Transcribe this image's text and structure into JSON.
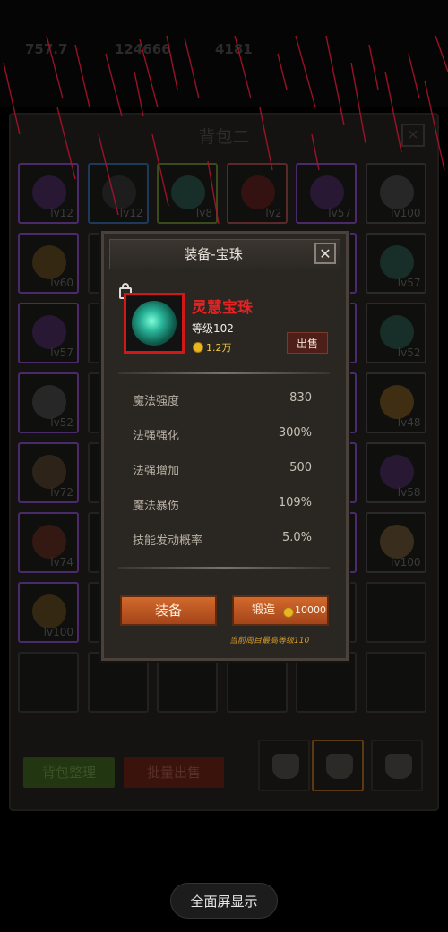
{
  "topbar": {
    "res1": "757.7",
    "res2": "124666",
    "res3": "4181"
  },
  "bag": {
    "title": "背包二",
    "sort_label": "背包整理",
    "bulk_sell_label": "批量出售",
    "slots": [
      {
        "lvl": "lv12",
        "color": "#5a2a7a"
      },
      {
        "lvl": "lv12",
        "color": "#3a3a3a"
      },
      {
        "lvl": "lv8",
        "color": "#2a6a5a"
      },
      {
        "lvl": "lv2",
        "color": "#7a1a1a"
      },
      {
        "lvl": "lv57",
        "color": "#5a2a7a"
      },
      {
        "lvl": "lv100",
        "color": "#555555"
      },
      {
        "lvl": "lv60",
        "color": "#7a5a1a"
      },
      {
        "lvl": "",
        "color": "#333333"
      },
      {
        "lvl": "",
        "color": "#333333"
      },
      {
        "lvl": "",
        "color": "#333333"
      },
      {
        "lvl": "7",
        "color": "#333333"
      },
      {
        "lvl": "lv57",
        "color": "#2a6a5a"
      },
      {
        "lvl": "lv57",
        "color": "#5a2a7a"
      },
      {
        "lvl": "",
        "color": "#333333"
      },
      {
        "lvl": "",
        "color": "#333333"
      },
      {
        "lvl": "",
        "color": "#333333"
      },
      {
        "lvl": "4",
        "color": "#333333"
      },
      {
        "lvl": "lv52",
        "color": "#2a6a5a"
      },
      {
        "lvl": "lv52",
        "color": "#555555"
      },
      {
        "lvl": "",
        "color": "#333333"
      },
      {
        "lvl": "",
        "color": "#333333"
      },
      {
        "lvl": "",
        "color": "#333333"
      },
      {
        "lvl": "3",
        "color": "#333333"
      },
      {
        "lvl": "lv48",
        "color": "#9a6a1a"
      },
      {
        "lvl": "lv72",
        "color": "#6a4a2a"
      },
      {
        "lvl": "",
        "color": "#333333"
      },
      {
        "lvl": "",
        "color": "#333333"
      },
      {
        "lvl": "",
        "color": "#333333"
      },
      {
        "lvl": "2",
        "color": "#333333"
      },
      {
        "lvl": "lv58",
        "color": "#5a2a7a"
      },
      {
        "lvl": "lv74",
        "color": "#7a2a1a"
      },
      {
        "lvl": "",
        "color": "#333333"
      },
      {
        "lvl": "",
        "color": "#333333"
      },
      {
        "lvl": "",
        "color": "#333333"
      },
      {
        "lvl": "00",
        "color": "#333333"
      },
      {
        "lvl": "lv100",
        "color": "#8a6a3a"
      },
      {
        "lvl": "lv100",
        "color": "#7a5a1a"
      },
      {
        "lvl": "",
        "color": "#333333"
      },
      {
        "lvl": "",
        "color": "#333333"
      },
      {
        "lvl": "",
        "color": "#333333"
      },
      {
        "lvl": "",
        "color": "#333333"
      },
      {
        "lvl": "",
        "color": "#333333"
      },
      {
        "lvl": "",
        "color": "#333333"
      },
      {
        "lvl": "",
        "color": "#333333"
      },
      {
        "lvl": "",
        "color": "#333333"
      },
      {
        "lvl": "",
        "color": "#333333"
      },
      {
        "lvl": "",
        "color": "#333333"
      },
      {
        "lvl": "",
        "color": "#333333"
      }
    ]
  },
  "modal": {
    "title": "装备-宝珠",
    "close_icon": "close-icon",
    "item_name": "灵慧宝珠",
    "item_level": "等级102",
    "item_price": "1.2万",
    "sell_label": "出售",
    "stats": [
      {
        "name": "魔法强度",
        "value": "830"
      },
      {
        "name": "法强强化",
        "value": "300%"
      },
      {
        "name": "法强增加",
        "value": "500"
      },
      {
        "name": "魔法暴伤",
        "value": "109%"
      },
      {
        "name": "技能发动概率",
        "value": "5.0%"
      }
    ],
    "equip_label": "装备",
    "forge_label": "锻造",
    "forge_cost": "10000",
    "forge_note": "当前周目最高等级110"
  },
  "fullscreen_label": "全面屏显示",
  "colors": {
    "accent": "#c4561f",
    "item_name": "#e32222",
    "gold": "#e8b623"
  }
}
